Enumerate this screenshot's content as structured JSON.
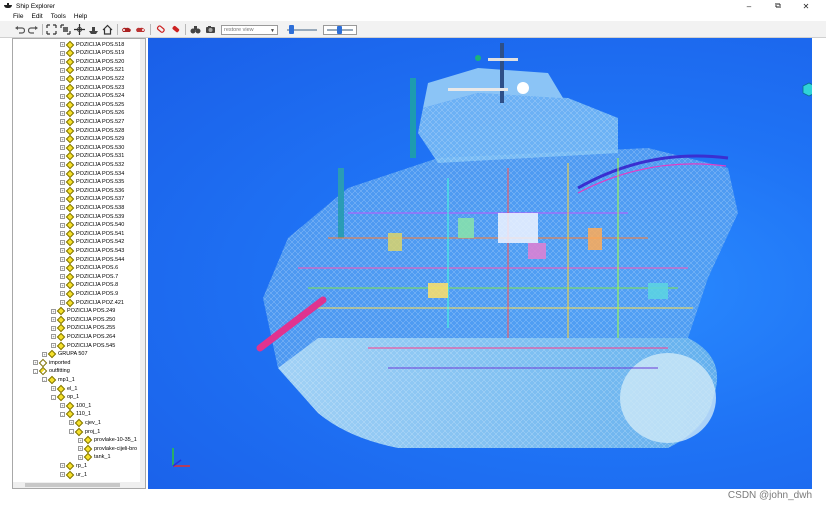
{
  "window": {
    "title": "Ship Explorer",
    "minimize_glyph": "–",
    "restore_glyph": "⧉",
    "close_glyph": "✕"
  },
  "menu": {
    "items": [
      "File",
      "Edit",
      "Tools",
      "Help"
    ]
  },
  "toolbar": {
    "view_select_value": "restore view",
    "icons": [
      "undo-icon",
      "redo-icon",
      "fit-all-icon",
      "fit-selection-icon",
      "move-icon",
      "ship-view-icon",
      "home-icon",
      "measure-icon",
      "section-icon",
      "highlight-icon",
      "selection-icon",
      "binoculars-icon",
      "camera-icon"
    ]
  },
  "tree": {
    "rows": [
      {
        "label": "POZICIJA POS.518",
        "level": 2,
        "exp": "+"
      },
      {
        "label": "POZICIJA POS.519",
        "level": 2,
        "exp": "+"
      },
      {
        "label": "POZICIJA POS.520",
        "level": 2,
        "exp": "+"
      },
      {
        "label": "POZICIJA POS.521",
        "level": 2,
        "exp": "+"
      },
      {
        "label": "POZICIJA POS.522",
        "level": 2,
        "exp": "+"
      },
      {
        "label": "POZICIJA POS.523",
        "level": 2,
        "exp": "+"
      },
      {
        "label": "POZICIJA POS.524",
        "level": 2,
        "exp": "+"
      },
      {
        "label": "POZICIJA POS.525",
        "level": 2,
        "exp": "+"
      },
      {
        "label": "POZICIJA POS.526",
        "level": 2,
        "exp": "+"
      },
      {
        "label": "POZICIJA POS.527",
        "level": 2,
        "exp": "+"
      },
      {
        "label": "POZICIJA POS.528",
        "level": 2,
        "exp": "+"
      },
      {
        "label": "POZICIJA POS.529",
        "level": 2,
        "exp": "+"
      },
      {
        "label": "POZICIJA POS.530",
        "level": 2,
        "exp": "+"
      },
      {
        "label": "POZICIJA POS.531",
        "level": 2,
        "exp": "+"
      },
      {
        "label": "POZICIJA POS.532",
        "level": 2,
        "exp": "+"
      },
      {
        "label": "POZICIJA POS.534",
        "level": 2,
        "exp": "+"
      },
      {
        "label": "POZICIJA POS.535",
        "level": 2,
        "exp": "+"
      },
      {
        "label": "POZICIJA POS.536",
        "level": 2,
        "exp": "+"
      },
      {
        "label": "POZICIJA POS.537",
        "level": 2,
        "exp": "+"
      },
      {
        "label": "POZICIJA POS.538",
        "level": 2,
        "exp": "+"
      },
      {
        "label": "POZICIJA POS.539",
        "level": 2,
        "exp": "+"
      },
      {
        "label": "POZICIJA POS.540",
        "level": 2,
        "exp": "+"
      },
      {
        "label": "POZICIJA POS.541",
        "level": 2,
        "exp": "+"
      },
      {
        "label": "POZICIJA POS.542",
        "level": 2,
        "exp": "+"
      },
      {
        "label": "POZICIJA POS.543",
        "level": 2,
        "exp": "+"
      },
      {
        "label": "POZICIJA POS.544",
        "level": 2,
        "exp": "+"
      },
      {
        "label": "POZICIJA POS.6",
        "level": 2,
        "exp": "+"
      },
      {
        "label": "POZICIJA POS.7",
        "level": 2,
        "exp": "+"
      },
      {
        "label": "POZICIJA POS.8",
        "level": 2,
        "exp": "+"
      },
      {
        "label": "POZICIJA POS.9",
        "level": 2,
        "exp": "+"
      },
      {
        "label": "POZICIJA POZ.421",
        "level": 2,
        "exp": "+"
      },
      {
        "label": "POZICIJA POS.249",
        "level": 1,
        "exp": "+"
      },
      {
        "label": "POZICIJA POS.250",
        "level": 1,
        "exp": "+"
      },
      {
        "label": "POZICIJA POS.255",
        "level": 1,
        "exp": "+"
      },
      {
        "label": "POZICIJA POS.264",
        "level": 1,
        "exp": "+"
      },
      {
        "label": "POZICIJA POS.545",
        "level": 1,
        "exp": "+"
      },
      {
        "label": "GRUPA 507",
        "level": 0,
        "exp": "+"
      },
      {
        "label": "imported",
        "level": -1,
        "exp": "+",
        "icon": "empty"
      },
      {
        "label": "outfitting",
        "level": -1,
        "exp": "-",
        "icon": "half"
      },
      {
        "label": "mp1_1",
        "level": 0,
        "exp": "-"
      },
      {
        "label": "el_1",
        "level": 1,
        "exp": "+"
      },
      {
        "label": "op_1",
        "level": 1,
        "exp": "-"
      },
      {
        "label": "100_1",
        "level": 2,
        "exp": "+"
      },
      {
        "label": "110_1",
        "level": 2,
        "exp": "-"
      },
      {
        "label": "cjev_1",
        "level": 3,
        "exp": "+"
      },
      {
        "label": "proj_1",
        "level": 3,
        "exp": "-"
      },
      {
        "label": "provlake-10-35_1",
        "level": 4,
        "exp": "+"
      },
      {
        "label": "provlake-cijeli-bro",
        "level": 4,
        "exp": "+"
      },
      {
        "label": "tank_1",
        "level": 4,
        "exp": "+"
      },
      {
        "label": "rp_1",
        "level": 2,
        "exp": "+"
      },
      {
        "label": "ur_1",
        "level": 2,
        "exp": "+"
      }
    ]
  },
  "watermark": "CSDN @john_dwh",
  "colors": {
    "viewport_bg": "#1f73f5",
    "tree_node": "#f5e02a",
    "pipe_pink": "#e0338f",
    "hull_ghost": "#a8d8f0"
  }
}
